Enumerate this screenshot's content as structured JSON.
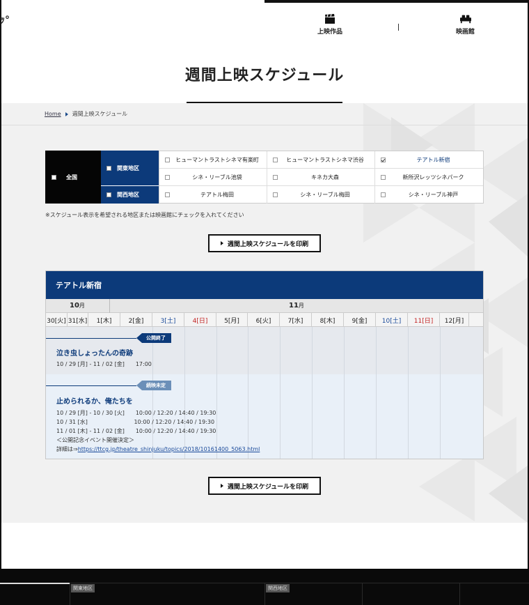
{
  "header": {
    "logo_fragment": "ｯ°",
    "nav": [
      {
        "label": "上映作品",
        "icon": "clapperboard-icon"
      },
      {
        "label": "映画館",
        "icon": "sofa-icon"
      }
    ]
  },
  "page_title": "週間上映スケジュール",
  "breadcrumb": {
    "home": "Home",
    "current": "週間上映スケジュール"
  },
  "filter": {
    "all_label": "全国",
    "regions": [
      {
        "label": "関東地区"
      },
      {
        "label": "関西地区"
      }
    ],
    "theaters": [
      {
        "label": "ヒューマントラストシネマ有楽町",
        "checked": false
      },
      {
        "label": "ヒューマントラストシネマ渋谷",
        "checked": false
      },
      {
        "label": "テアトル新宿",
        "checked": true
      },
      {
        "label": "シネ・リーブル池袋",
        "checked": false
      },
      {
        "label": "キネカ大森",
        "checked": false
      },
      {
        "label": "新所沢レッツシネパーク",
        "checked": false
      },
      {
        "label": "テアトル梅田",
        "checked": false
      },
      {
        "label": "シネ・リーブル梅田",
        "checked": false
      },
      {
        "label": "シネ・リーブル神戸",
        "checked": false
      }
    ],
    "note": "※スケジュール表示を希望される地区または映画館にチェックを入れてください"
  },
  "print_button_label": "週間上映スケジュールを印刷",
  "schedule": {
    "theater": "テアトル新宿",
    "months": [
      {
        "num": "10",
        "unit": "月"
      },
      {
        "num": "11",
        "unit": "月"
      }
    ],
    "days": [
      {
        "label": "30[火]",
        "type": "weekday"
      },
      {
        "label": "31[水]",
        "type": "weekday"
      },
      {
        "label": "1[木]",
        "type": "weekday"
      },
      {
        "label": "2[金]",
        "type": "weekday"
      },
      {
        "label": "3[土]",
        "type": "sat"
      },
      {
        "label": "4[日]",
        "type": "sun"
      },
      {
        "label": "5[月]",
        "type": "weekday"
      },
      {
        "label": "6[火]",
        "type": "weekday"
      },
      {
        "label": "7[水]",
        "type": "weekday"
      },
      {
        "label": "8[木]",
        "type": "weekday"
      },
      {
        "label": "9[金]",
        "type": "weekday"
      },
      {
        "label": "10[土]",
        "type": "sat"
      },
      {
        "label": "11[日]",
        "type": "sun"
      },
      {
        "label": "12[月]",
        "type": "weekday"
      }
    ],
    "films": [
      {
        "badge": "公開終了",
        "title": "泣き虫しょったんの奇跡",
        "lines": [
          "10 / 29 [月] - 11 / 02 [金]　　17:00"
        ]
      },
      {
        "badge": "続映未定",
        "title": "止められるか、俺たちを",
        "lines": [
          "10 / 29 [月] - 10 / 30 [火]　　10:00 / 12:20 / 14:40 / 19:30",
          "10 / 31 [水]　　　　　　　　 10:00 / 12:20 / 14:40 / 19:30",
          "11 / 01 [木] - 11 / 02 [金]　　10:00 / 12:20 / 14:40 / 19:30",
          "＜公開記念イベント開催決定＞"
        ],
        "detail_prefix": "詳細は⇒",
        "detail_link": "https://ttcg.jp/theatre_shinjuku/topics/2018/10161400_5063.html"
      }
    ]
  },
  "footer": {
    "tags": [
      "関東地区",
      "関西地区"
    ]
  }
}
